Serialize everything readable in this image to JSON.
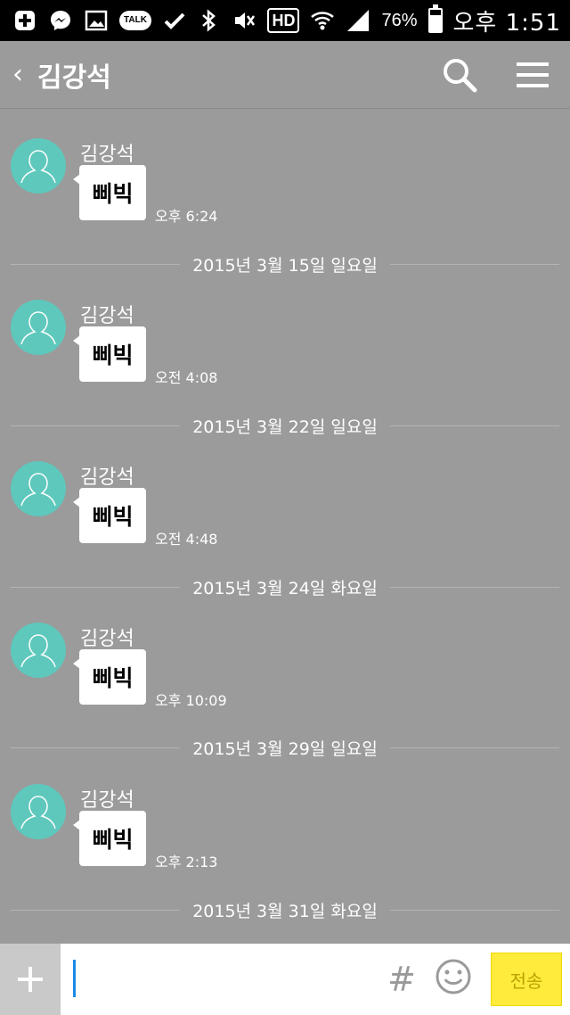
{
  "status_bar": {
    "talk_label": "TALK",
    "hd_label": "HD",
    "battery": "76%",
    "battery_level": 0.76,
    "time": "오후 1:51"
  },
  "header": {
    "back_label": "‹",
    "title": "김강석"
  },
  "messages": [
    {
      "sender": "김강석",
      "text": "삐빅",
      "time": "오후 6:24"
    },
    {
      "date": "2015년 3월 15일 일요일"
    },
    {
      "sender": "김강석",
      "text": "삐빅",
      "time": "오전 4:08"
    },
    {
      "date": "2015년 3월 22일 일요일"
    },
    {
      "sender": "김강석",
      "text": "삐빅",
      "time": "오전 4:48"
    },
    {
      "date": "2015년 3월 24일 화요일"
    },
    {
      "sender": "김강석",
      "text": "삐빅",
      "time": "오후 10:09"
    },
    {
      "date": "2015년 3월 29일 일요일"
    },
    {
      "sender": "김강석",
      "text": "삐빅",
      "time": "오후 2:13"
    },
    {
      "date": "2015년 3월 31일 화요일"
    }
  ],
  "input_bar": {
    "input_value": "",
    "hash_label": "#",
    "send_label": "전송"
  },
  "colors": {
    "background": "#9b9b9b",
    "avatar": "#5ec8bc",
    "send_button": "#ffeb3b",
    "caret": "#1e88e5"
  }
}
